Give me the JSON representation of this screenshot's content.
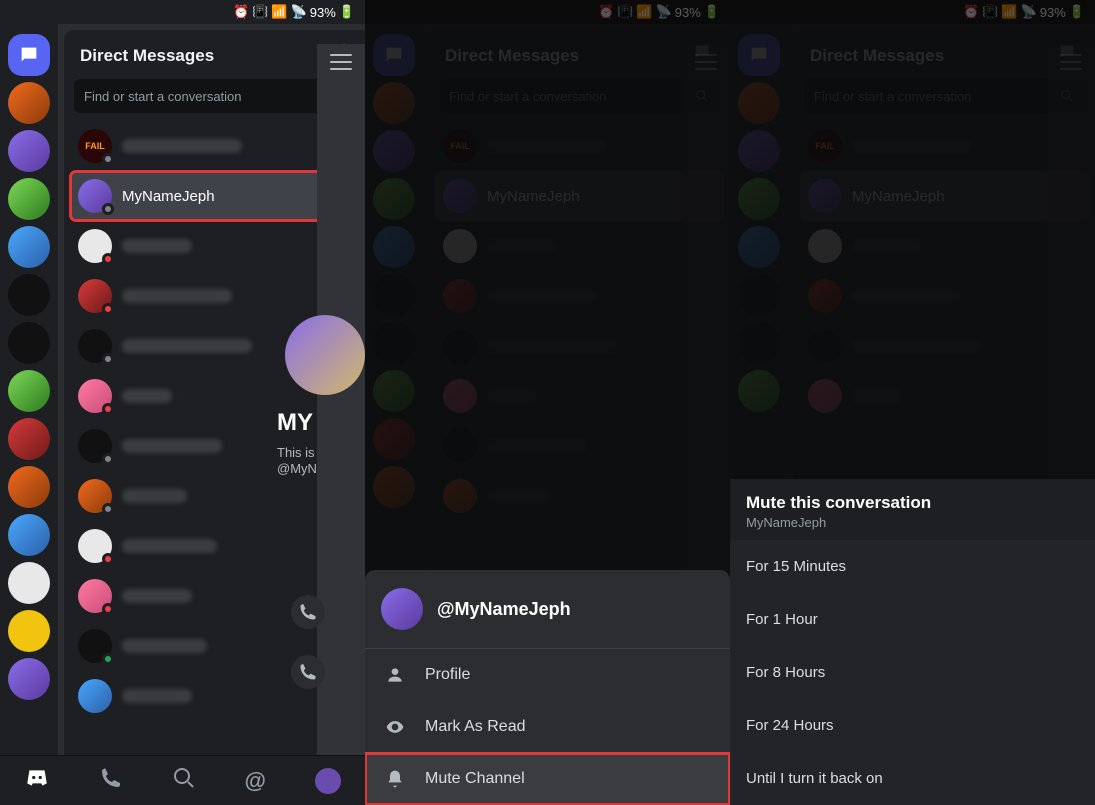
{
  "status": {
    "battery": "93%",
    "icons": [
      "alarm-icon",
      "vibrate-icon",
      "wifi-icon",
      "signal-icon",
      "battery-icon"
    ]
  },
  "dm": {
    "header_title": "Direct Messages",
    "search_placeholder": "Find or start a conversation",
    "selected_name": "MyNameJeph",
    "highlighted_name": "MyNameJeph"
  },
  "peek": {
    "name_prefix": "MY",
    "intro": "This is",
    "handle": "@MyN"
  },
  "sheet": {
    "user_handle": "@MyNameJeph",
    "rows": {
      "profile": "Profile",
      "mark_read": "Mark As Read",
      "mute": "Mute Channel"
    }
  },
  "mute": {
    "title": "Mute this conversation",
    "subtitle": "MyNameJeph",
    "options": {
      "m15": "For 15 Minutes",
      "h1": "For 1 Hour",
      "h8": "For 8 Hours",
      "h24": "For 24 Hours",
      "forever": "Until I turn it back on"
    }
  }
}
